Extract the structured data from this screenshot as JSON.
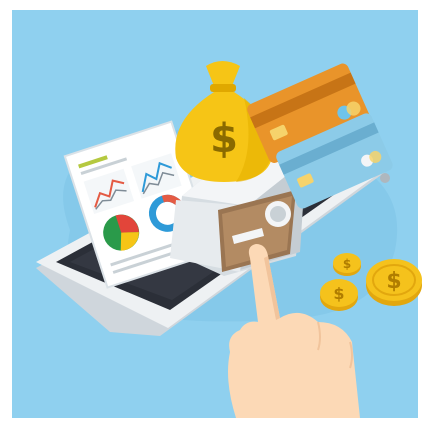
{
  "illustration": {
    "money_bag_symbol": "$",
    "coin_symbol": "$",
    "colors": {
      "sky": "#8fd0ef",
      "blob": "#7ec3e6",
      "phone_body": "#e7ebee",
      "phone_screen": "#2b2f38",
      "money_bag": "#f6c516",
      "safe_door": "#9a7552",
      "card_orange": "#e9942a",
      "card_blue": "#8ccbe8",
      "coin": "#f5c21c",
      "hand": "#fcd9b6"
    },
    "icons": [
      "smartphone-icon",
      "safe-icon",
      "money-bag-icon",
      "credit-card-icon",
      "report-icon",
      "coin-icon",
      "hand-icon"
    ]
  }
}
